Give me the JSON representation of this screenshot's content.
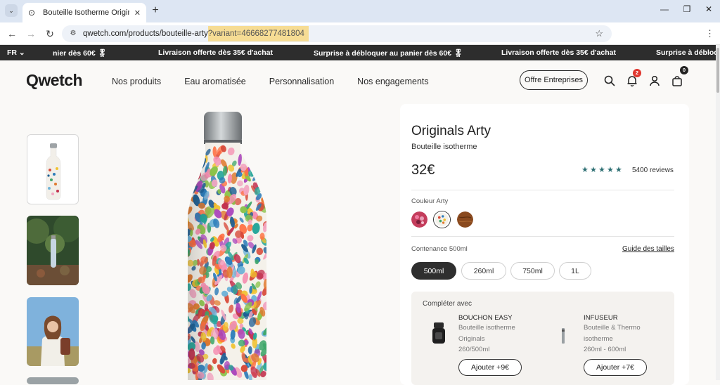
{
  "browser": {
    "tab_title": "Bouteille Isotherme Originals A",
    "url_base": "qwetch.com/products/bouteille-arty",
    "url_query": "?variant=46668277481804"
  },
  "announcement": {
    "language": "FR",
    "messages": [
      "nier dès 60€ 🎖",
      "Livraison offerte dès 35€ d'achat",
      "Surprise à débloquer au panier dès 60€ 🎖",
      "Livraison offerte dès 35€ d'achat",
      "Surprise à débloq"
    ]
  },
  "header": {
    "logo": "Qwetch",
    "nav": [
      "Nos produits",
      "Eau aromatisée",
      "Personnalisation",
      "Nos engagements"
    ],
    "enterprise_button": "Offre Entreprises",
    "notification_count": "2",
    "cart_count": "0"
  },
  "product": {
    "title": "Originals Arty",
    "subtitle": "Bouteille isotherme",
    "price": "32€",
    "rating": 5,
    "reviews": "5400 reviews",
    "color_label": "Couleur Arty",
    "capacity_label": "Contenance 500ml",
    "size_guide": "Guide des tailles",
    "sizes": [
      "500ml",
      "260ml",
      "750ml",
      "1L"
    ],
    "selected_size": "500ml"
  },
  "upsell": {
    "title": "Compléter avec",
    "items": [
      {
        "name": "BOUCHON EASY",
        "desc": [
          "Bouteille isotherme",
          "Originals",
          "260/500ml"
        ],
        "button": "Ajouter +9€"
      },
      {
        "name": "INFUSEUR",
        "desc": [
          "Bouteille & Thermo",
          "isotherme",
          "260ml - 600ml"
        ],
        "button": "Ajouter +7€"
      }
    ]
  },
  "colors": {
    "accent_star": "#2d6f73",
    "announce_bg": "#2d2d2d",
    "selected_size_bg": "#2f2f2f"
  }
}
